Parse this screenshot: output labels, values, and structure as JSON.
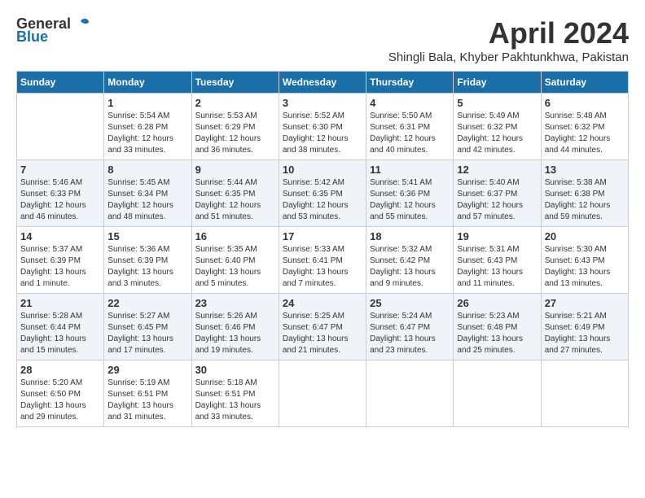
{
  "header": {
    "logo_general": "General",
    "logo_blue": "Blue",
    "title": "April 2024",
    "location": "Shingli Bala, Khyber Pakhtunkhwa, Pakistan"
  },
  "weekdays": [
    "Sunday",
    "Monday",
    "Tuesday",
    "Wednesday",
    "Thursday",
    "Friday",
    "Saturday"
  ],
  "weeks": [
    [
      {
        "day": "",
        "sunrise": "",
        "sunset": "",
        "daylight": ""
      },
      {
        "day": "1",
        "sunrise": "Sunrise: 5:54 AM",
        "sunset": "Sunset: 6:28 PM",
        "daylight": "Daylight: 12 hours and 33 minutes."
      },
      {
        "day": "2",
        "sunrise": "Sunrise: 5:53 AM",
        "sunset": "Sunset: 6:29 PM",
        "daylight": "Daylight: 12 hours and 36 minutes."
      },
      {
        "day": "3",
        "sunrise": "Sunrise: 5:52 AM",
        "sunset": "Sunset: 6:30 PM",
        "daylight": "Daylight: 12 hours and 38 minutes."
      },
      {
        "day": "4",
        "sunrise": "Sunrise: 5:50 AM",
        "sunset": "Sunset: 6:31 PM",
        "daylight": "Daylight: 12 hours and 40 minutes."
      },
      {
        "day": "5",
        "sunrise": "Sunrise: 5:49 AM",
        "sunset": "Sunset: 6:32 PM",
        "daylight": "Daylight: 12 hours and 42 minutes."
      },
      {
        "day": "6",
        "sunrise": "Sunrise: 5:48 AM",
        "sunset": "Sunset: 6:32 PM",
        "daylight": "Daylight: 12 hours and 44 minutes."
      }
    ],
    [
      {
        "day": "7",
        "sunrise": "Sunrise: 5:46 AM",
        "sunset": "Sunset: 6:33 PM",
        "daylight": "Daylight: 12 hours and 46 minutes."
      },
      {
        "day": "8",
        "sunrise": "Sunrise: 5:45 AM",
        "sunset": "Sunset: 6:34 PM",
        "daylight": "Daylight: 12 hours and 48 minutes."
      },
      {
        "day": "9",
        "sunrise": "Sunrise: 5:44 AM",
        "sunset": "Sunset: 6:35 PM",
        "daylight": "Daylight: 12 hours and 51 minutes."
      },
      {
        "day": "10",
        "sunrise": "Sunrise: 5:42 AM",
        "sunset": "Sunset: 6:35 PM",
        "daylight": "Daylight: 12 hours and 53 minutes."
      },
      {
        "day": "11",
        "sunrise": "Sunrise: 5:41 AM",
        "sunset": "Sunset: 6:36 PM",
        "daylight": "Daylight: 12 hours and 55 minutes."
      },
      {
        "day": "12",
        "sunrise": "Sunrise: 5:40 AM",
        "sunset": "Sunset: 6:37 PM",
        "daylight": "Daylight: 12 hours and 57 minutes."
      },
      {
        "day": "13",
        "sunrise": "Sunrise: 5:38 AM",
        "sunset": "Sunset: 6:38 PM",
        "daylight": "Daylight: 12 hours and 59 minutes."
      }
    ],
    [
      {
        "day": "14",
        "sunrise": "Sunrise: 5:37 AM",
        "sunset": "Sunset: 6:39 PM",
        "daylight": "Daylight: 13 hours and 1 minute."
      },
      {
        "day": "15",
        "sunrise": "Sunrise: 5:36 AM",
        "sunset": "Sunset: 6:39 PM",
        "daylight": "Daylight: 13 hours and 3 minutes."
      },
      {
        "day": "16",
        "sunrise": "Sunrise: 5:35 AM",
        "sunset": "Sunset: 6:40 PM",
        "daylight": "Daylight: 13 hours and 5 minutes."
      },
      {
        "day": "17",
        "sunrise": "Sunrise: 5:33 AM",
        "sunset": "Sunset: 6:41 PM",
        "daylight": "Daylight: 13 hours and 7 minutes."
      },
      {
        "day": "18",
        "sunrise": "Sunrise: 5:32 AM",
        "sunset": "Sunset: 6:42 PM",
        "daylight": "Daylight: 13 hours and 9 minutes."
      },
      {
        "day": "19",
        "sunrise": "Sunrise: 5:31 AM",
        "sunset": "Sunset: 6:43 PM",
        "daylight": "Daylight: 13 hours and 11 minutes."
      },
      {
        "day": "20",
        "sunrise": "Sunrise: 5:30 AM",
        "sunset": "Sunset: 6:43 PM",
        "daylight": "Daylight: 13 hours and 13 minutes."
      }
    ],
    [
      {
        "day": "21",
        "sunrise": "Sunrise: 5:28 AM",
        "sunset": "Sunset: 6:44 PM",
        "daylight": "Daylight: 13 hours and 15 minutes."
      },
      {
        "day": "22",
        "sunrise": "Sunrise: 5:27 AM",
        "sunset": "Sunset: 6:45 PM",
        "daylight": "Daylight: 13 hours and 17 minutes."
      },
      {
        "day": "23",
        "sunrise": "Sunrise: 5:26 AM",
        "sunset": "Sunset: 6:46 PM",
        "daylight": "Daylight: 13 hours and 19 minutes."
      },
      {
        "day": "24",
        "sunrise": "Sunrise: 5:25 AM",
        "sunset": "Sunset: 6:47 PM",
        "daylight": "Daylight: 13 hours and 21 minutes."
      },
      {
        "day": "25",
        "sunrise": "Sunrise: 5:24 AM",
        "sunset": "Sunset: 6:47 PM",
        "daylight": "Daylight: 13 hours and 23 minutes."
      },
      {
        "day": "26",
        "sunrise": "Sunrise: 5:23 AM",
        "sunset": "Sunset: 6:48 PM",
        "daylight": "Daylight: 13 hours and 25 minutes."
      },
      {
        "day": "27",
        "sunrise": "Sunrise: 5:21 AM",
        "sunset": "Sunset: 6:49 PM",
        "daylight": "Daylight: 13 hours and 27 minutes."
      }
    ],
    [
      {
        "day": "28",
        "sunrise": "Sunrise: 5:20 AM",
        "sunset": "Sunset: 6:50 PM",
        "daylight": "Daylight: 13 hours and 29 minutes."
      },
      {
        "day": "29",
        "sunrise": "Sunrise: 5:19 AM",
        "sunset": "Sunset: 6:51 PM",
        "daylight": "Daylight: 13 hours and 31 minutes."
      },
      {
        "day": "30",
        "sunrise": "Sunrise: 5:18 AM",
        "sunset": "Sunset: 6:51 PM",
        "daylight": "Daylight: 13 hours and 33 minutes."
      },
      {
        "day": "",
        "sunrise": "",
        "sunset": "",
        "daylight": ""
      },
      {
        "day": "",
        "sunrise": "",
        "sunset": "",
        "daylight": ""
      },
      {
        "day": "",
        "sunrise": "",
        "sunset": "",
        "daylight": ""
      },
      {
        "day": "",
        "sunrise": "",
        "sunset": "",
        "daylight": ""
      }
    ]
  ]
}
